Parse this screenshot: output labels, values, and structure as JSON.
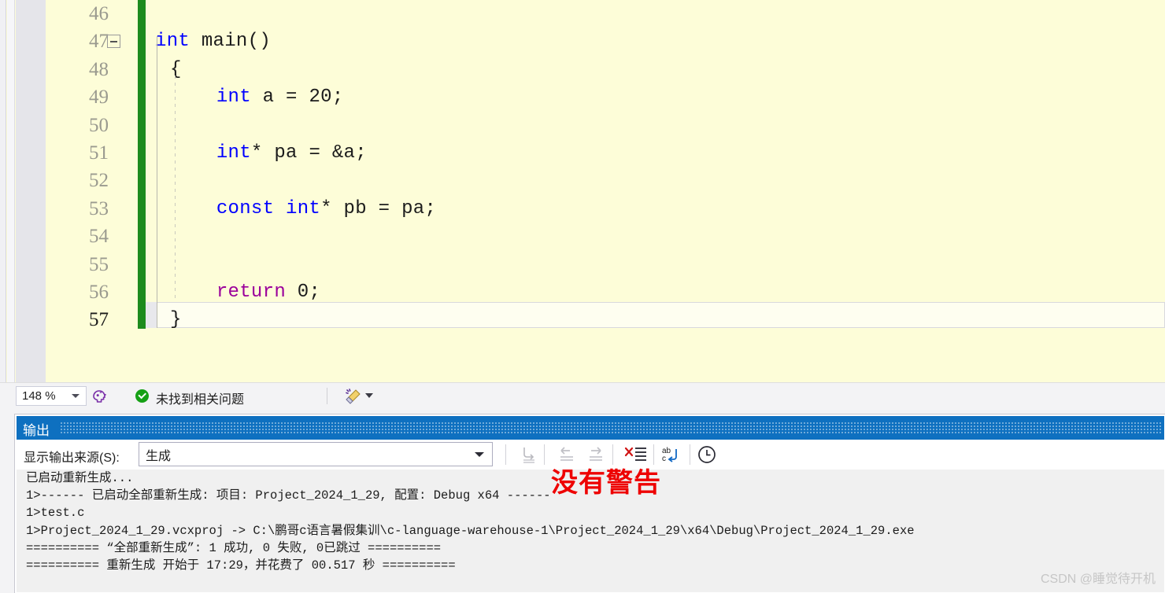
{
  "editor": {
    "zoom_level": "148 %",
    "lines": [
      {
        "num": "46",
        "text": "",
        "current": false
      },
      {
        "num": "47",
        "text": "int main()",
        "current": false
      },
      {
        "num": "48",
        "text": "{",
        "current": false
      },
      {
        "num": "49",
        "text": "    int a = 20;",
        "current": false
      },
      {
        "num": "50",
        "text": "",
        "current": false
      },
      {
        "num": "51",
        "text": "    int* pa = &a;",
        "current": false
      },
      {
        "num": "52",
        "text": "",
        "current": false
      },
      {
        "num": "53",
        "text": "    const int* pb = pa;",
        "current": false
      },
      {
        "num": "54",
        "text": "",
        "current": false
      },
      {
        "num": "55",
        "text": "",
        "current": false
      },
      {
        "num": "56",
        "text": "    return 0;",
        "current": false
      },
      {
        "num": "57",
        "text": "}",
        "current": true
      }
    ]
  },
  "status_bar": {
    "zoom_value": "148 %",
    "brain_icon": "intellisense-head-icon",
    "problem_status": "未找到相关问题",
    "ok_icon": "green-check-icon",
    "cleanup_icon": "code-cleanup-broom-icon"
  },
  "output_panel": {
    "title": "输出",
    "source_label": "显示输出来源(S):",
    "source_value": "生成",
    "toolbar_icons": [
      "go-to-message-icon",
      "find-previous-icon",
      "find-next-icon",
      "clear-all-icon",
      "toggle-word-wrap-icon",
      "show-timestamps-icon"
    ],
    "lines": [
      "已启动重新生成...",
      "1>------ 已启动全部重新生成: 项目: Project_2024_1_29, 配置: Debug x64 ------",
      "1>test.c",
      "1>Project_2024_1_29.vcxproj -> C:\\鹏哥c语言暑假集训\\c-language-warehouse-1\\Project_2024_1_29\\x64\\Debug\\Project_2024_1_29.exe",
      "========== “全部重新生成”: 1 成功, 0 失败, 0已跳过 ==========",
      "========== 重新生成 开始于 17:29，并花费了 00.517 秒 =========="
    ]
  },
  "annotation": {
    "text": "没有警告",
    "color": "#ee0000"
  },
  "watermark": {
    "text": "CSDN @睡觉待开机"
  },
  "colors": {
    "editor_background": "#fdfdd8",
    "gutter": "#e5e5ea",
    "change_bar": "#1d8b1d",
    "keyword": "#0000ff",
    "control_keyword": "#9b009b",
    "panel_header": "#0e70c0",
    "output_background": "#f0f0f0"
  }
}
